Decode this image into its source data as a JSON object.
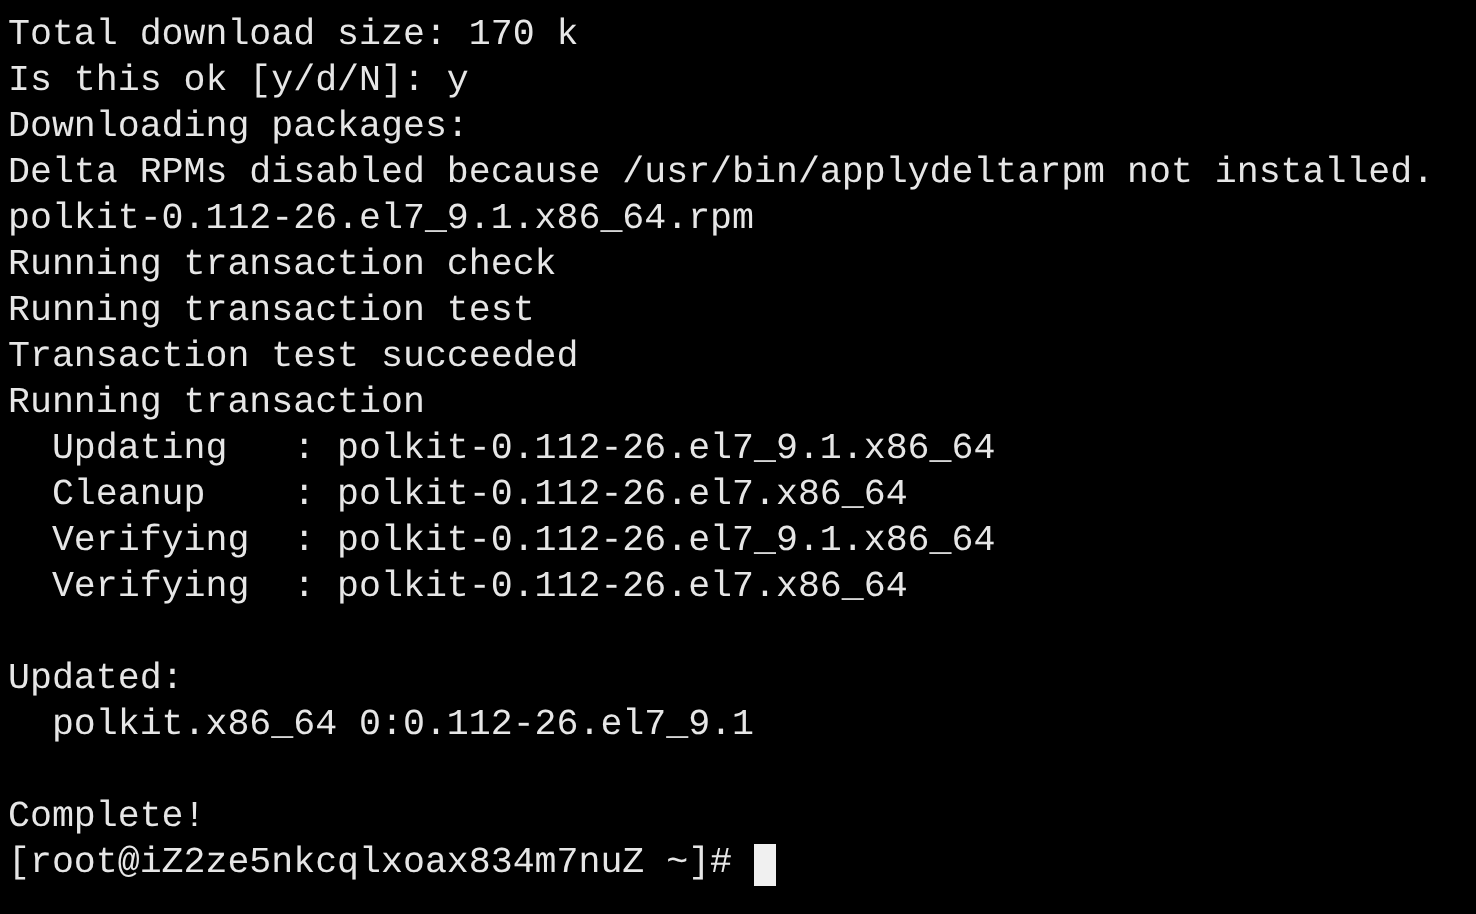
{
  "terminal": {
    "blocks": [
      [
        "Total download size: 170 k",
        "Is this ok [y/d/N]: y",
        "Downloading packages:",
        "Delta RPMs disabled because /usr/bin/applydeltarpm not installed.",
        "polkit-0.112-26.el7_9.1.x86_64.rpm",
        "Running transaction check",
        "Running transaction test",
        "Transaction test succeeded",
        "Running transaction",
        "  Updating   : polkit-0.112-26.el7_9.1.x86_64",
        "  Cleanup    : polkit-0.112-26.el7.x86_64",
        "  Verifying  : polkit-0.112-26.el7_9.1.x86_64",
        "  Verifying  : polkit-0.112-26.el7.x86_64"
      ],
      [
        "Updated:",
        "  polkit.x86_64 0:0.112-26.el7_9.1"
      ],
      [
        "Complete!"
      ]
    ],
    "prompt": {
      "text": "[root@iZ2ze5nkcqlxoax834m7nuZ ~]#",
      "cursor": true
    }
  }
}
